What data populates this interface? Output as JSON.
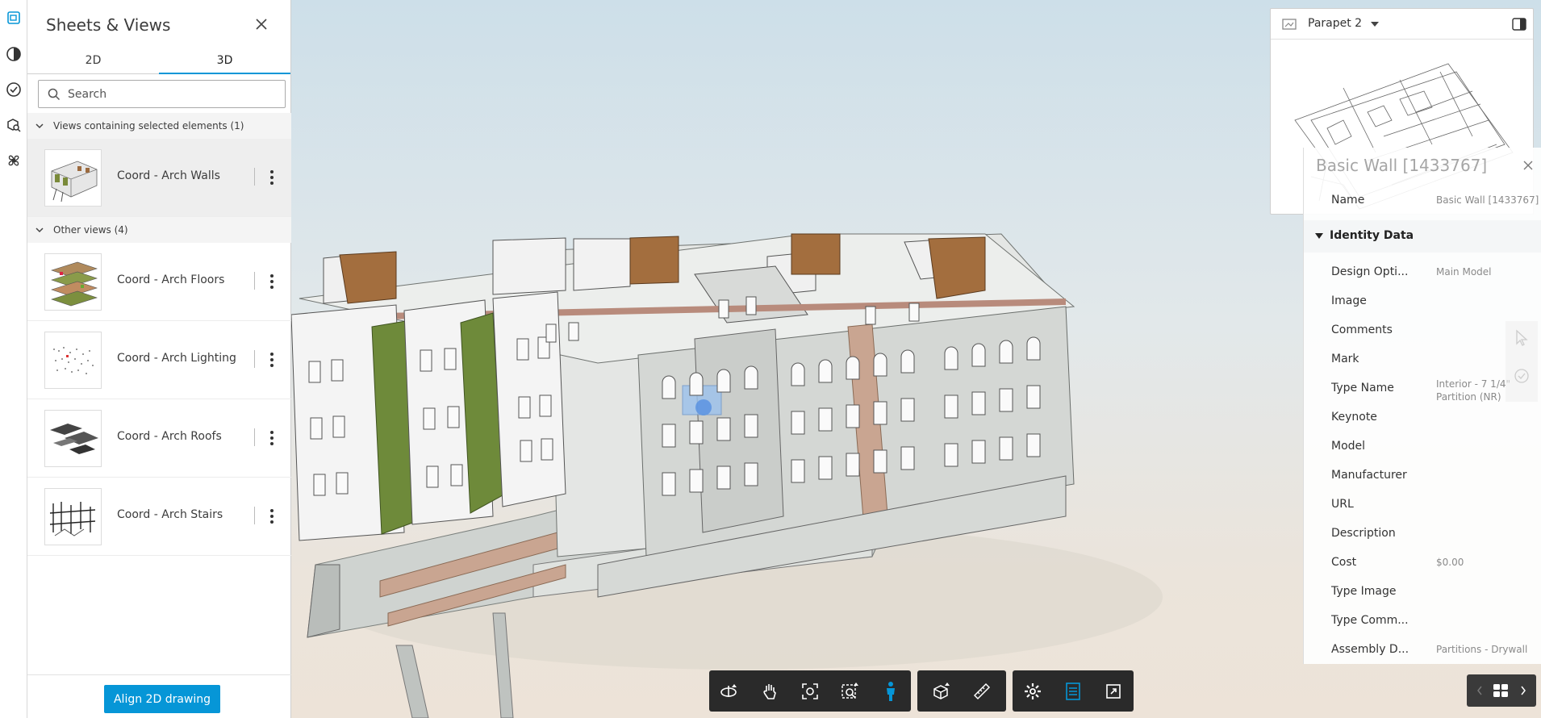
{
  "panel": {
    "title": "Sheets & Views",
    "tabs": [
      "2D",
      "3D"
    ],
    "active_tab": "3D",
    "search_placeholder": "Search",
    "section_selected": "Views containing selected elements (1)",
    "section_other": "Other views (4)",
    "selected_views": [
      {
        "name": "Coord - Arch Walls",
        "thumb": "arch-walls"
      }
    ],
    "other_views": [
      {
        "name": "Coord - Arch Floors",
        "thumb": "arch-floors"
      },
      {
        "name": "Coord - Arch Lighting",
        "thumb": "arch-lighting"
      },
      {
        "name": "Coord - Arch Roofs",
        "thumb": "arch-roofs"
      },
      {
        "name": "Coord - Arch Stairs",
        "thumb": "arch-stairs"
      }
    ],
    "align_button": "Align 2D drawing"
  },
  "minimap": {
    "view_name": "Parapet 2"
  },
  "properties": {
    "title": "Basic Wall [1433767]",
    "name_label": "Name",
    "name_value": "Basic Wall [1433767]",
    "group": "Identity Data",
    "rows": [
      {
        "label": "Design Opti...",
        "value": "Main Model"
      },
      {
        "label": "Image",
        "value": ""
      },
      {
        "label": "Comments",
        "value": ""
      },
      {
        "label": "Mark",
        "value": ""
      },
      {
        "label": "Type Name",
        "value": "Interior - 7 1/4\" Partition (NR)"
      },
      {
        "label": "Keynote",
        "value": ""
      },
      {
        "label": "Model",
        "value": ""
      },
      {
        "label": "Manufacturer",
        "value": ""
      },
      {
        "label": "URL",
        "value": ""
      },
      {
        "label": "Description",
        "value": ""
      },
      {
        "label": "Cost",
        "value": "$0.00"
      },
      {
        "label": "Type Image",
        "value": ""
      },
      {
        "label": "Type Comm...",
        "value": ""
      },
      {
        "label": "Assembly D...",
        "value": "Partitions - Drywall"
      }
    ]
  },
  "colors": {
    "accent": "#0696d7",
    "toolbar_bg": "#2a2a2a",
    "wall_brown": "#a0683a",
    "wall_green": "#6e8a3a"
  },
  "toolbar": {
    "group1": [
      "orbit-icon",
      "pan-icon",
      "fit-to-view-icon",
      "zoom-window-icon",
      "first-person-icon"
    ],
    "group2": [
      "explode-model-icon",
      "measure-icon"
    ],
    "group3": [
      "settings-icon",
      "properties-icon",
      "fullscreen-icon"
    ]
  }
}
